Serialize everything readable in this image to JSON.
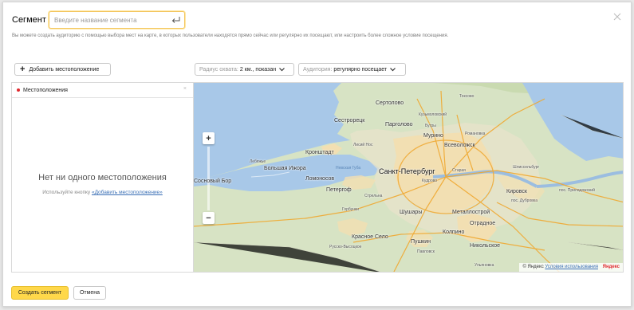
{
  "header": {
    "title": "Сегмент",
    "name_placeholder": "Введите название сегмента",
    "description": "Вы можете создать аудиторию с помощью выбора мест на карте, в которых пользователи находятся прямо сейчас или регулярно их посещают, или настроить более сложное условие посещения."
  },
  "toolbar": {
    "add_location_label": "Добавить местоположение",
    "radius_label": "Радиус охвата:",
    "radius_value": "2 км., показан",
    "audience_label": "Аудитория:",
    "audience_value": "регулярно посещает"
  },
  "locations_panel": {
    "header_label": "Местоположения",
    "empty_title": "Нет ни одного местоположения",
    "empty_hint_prefix": "Используйте кнопку",
    "empty_hint_link": "«Добавить местоположение»"
  },
  "map": {
    "zoom_in": "+",
    "zoom_out": "−",
    "places": {
      "sertolovo": "Сертолово",
      "sestroretsk": "Сестрорецк",
      "pargolovo": "Парголово",
      "bugry": "Бугры",
      "murino": "Мурино",
      "vsevolozhsk": "Всеволожск",
      "kronshtadt": "Кронштадт",
      "lisiy_nos": "Лисий Нос",
      "peterburg": "Санкт-Петербург",
      "bolshaya_izhora": "Большая Ижора",
      "lomonosov": "Ломоносов",
      "petergof": "Петергоф",
      "shushary": "Шушары",
      "metallostroy": "Металлострой",
      "otradnoe": "Отрадное",
      "kirovsk": "Кировск",
      "kolpino": "Колпино",
      "krasnoe_selo": "Красное Село",
      "pushkin": "Пушкин",
      "nikolskoe": "Никольское",
      "pavlovsk": "Павловск",
      "kuzmolovsky": "Кузьмоловский",
      "romanovka": "Романовка",
      "shlisselburg": "Шлиссельбург",
      "neva_bay": "Невская Губа",
      "toksovo": "Токсово",
      "sosnovy_bor": "Сосновый Бор",
      "ulyanovka": "Ульяновка",
      "dubrovka": "пос. Дубровка",
      "priladozhsky": "пос. Приладожский",
      "lebyazhye": "Лебяжье",
      "strelna": "Стрельна",
      "starya": "Старая",
      "kudrovo": "Кудрово",
      "russko_vysotskoe": "Русско-Высоцкое",
      "gorbunki": "Горбунки"
    },
    "copyright_text": "© Яндекс",
    "terms_link": "Условия использования",
    "logo": "Яндекс"
  },
  "footer": {
    "create_label": "Создать сегмент",
    "cancel_label": "Отмена"
  },
  "colors": {
    "accent_yellow": "#ffd84a",
    "water": "#a8c8e8",
    "land": "#d7e3c4",
    "city": "#f2dfb2",
    "roads": "#f0a830",
    "marker_red": "#e0292e"
  }
}
